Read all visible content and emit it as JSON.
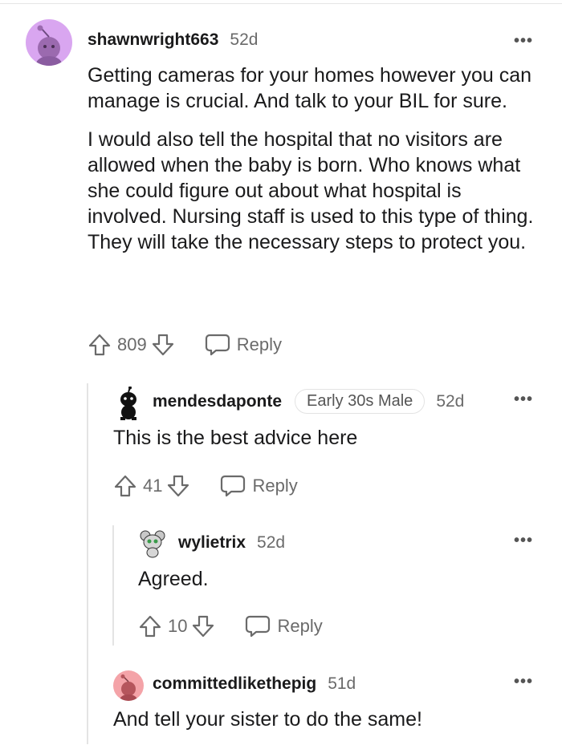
{
  "comments": [
    {
      "username": "shawnwright663",
      "age": "52d",
      "more_icon": "ellipsis-icon",
      "paragraphs": [
        "Getting cameras for your homes however you can manage is crucial. And talk to your BIL for sure.",
        "I would also tell the hospital that no visitors are allowed when the baby is born. Who knows what she could figure out about what hospital is involved. Nursing staff is used to this type of thing. They will take the necessary steps to protect you."
      ],
      "score": "809",
      "reply_label": "Reply",
      "avatar_color": "#d9a6f0"
    },
    {
      "username": "mendesdaponte",
      "flair": "Early 30s Male",
      "age": "52d",
      "paragraphs": [
        "This is the best advice here"
      ],
      "score": "41",
      "reply_label": "Reply"
    },
    {
      "username": "wylietrix",
      "age": "52d",
      "paragraphs": [
        "Agreed."
      ],
      "score": "10",
      "reply_label": "Reply"
    },
    {
      "username": "committedlikethepig",
      "age": "51d",
      "paragraphs": [
        "And tell your sister to do the same!"
      ],
      "avatar_color": "#f4a3a8"
    }
  ],
  "colors": {
    "meta_text": "#6a6a6a",
    "thread_line": "#e4e4e4"
  }
}
